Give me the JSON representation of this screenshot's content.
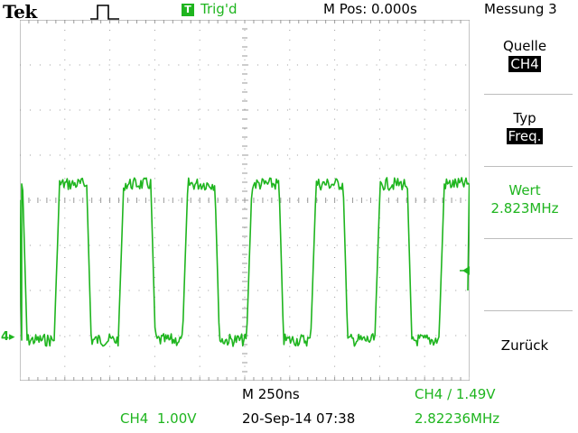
{
  "header": {
    "brand": "Tek",
    "trigger_badge": "T",
    "trigger_status": "Trig'd",
    "m_pos": "M Pos: 0.000s",
    "menu_title": "Messung 3"
  },
  "side_menu": {
    "source_label": "Quelle",
    "source_value": "CH4",
    "type_label": "Typ",
    "type_value": "Freq.",
    "value_label": "Wert",
    "value_value": "2.823MHz",
    "back_label": "Zurück"
  },
  "bottom": {
    "timebase": "M 250ns",
    "trigger_info": "CH4 ∕ 1.49V",
    "channel_scale": "CH4  1.00V",
    "datetime": "20-Sep-14 07:38",
    "frequency_readout": "2.82236MHz"
  },
  "channel_marker": "4",
  "colors": {
    "trace": "#1fb51f",
    "grid": "#9a9a9a",
    "background": "#ffffff",
    "text": "#000000"
  },
  "icons": [
    "pulse-icon",
    "trigger-position-icon",
    "trigger-level-icon",
    "channel-ground-icon"
  ]
}
